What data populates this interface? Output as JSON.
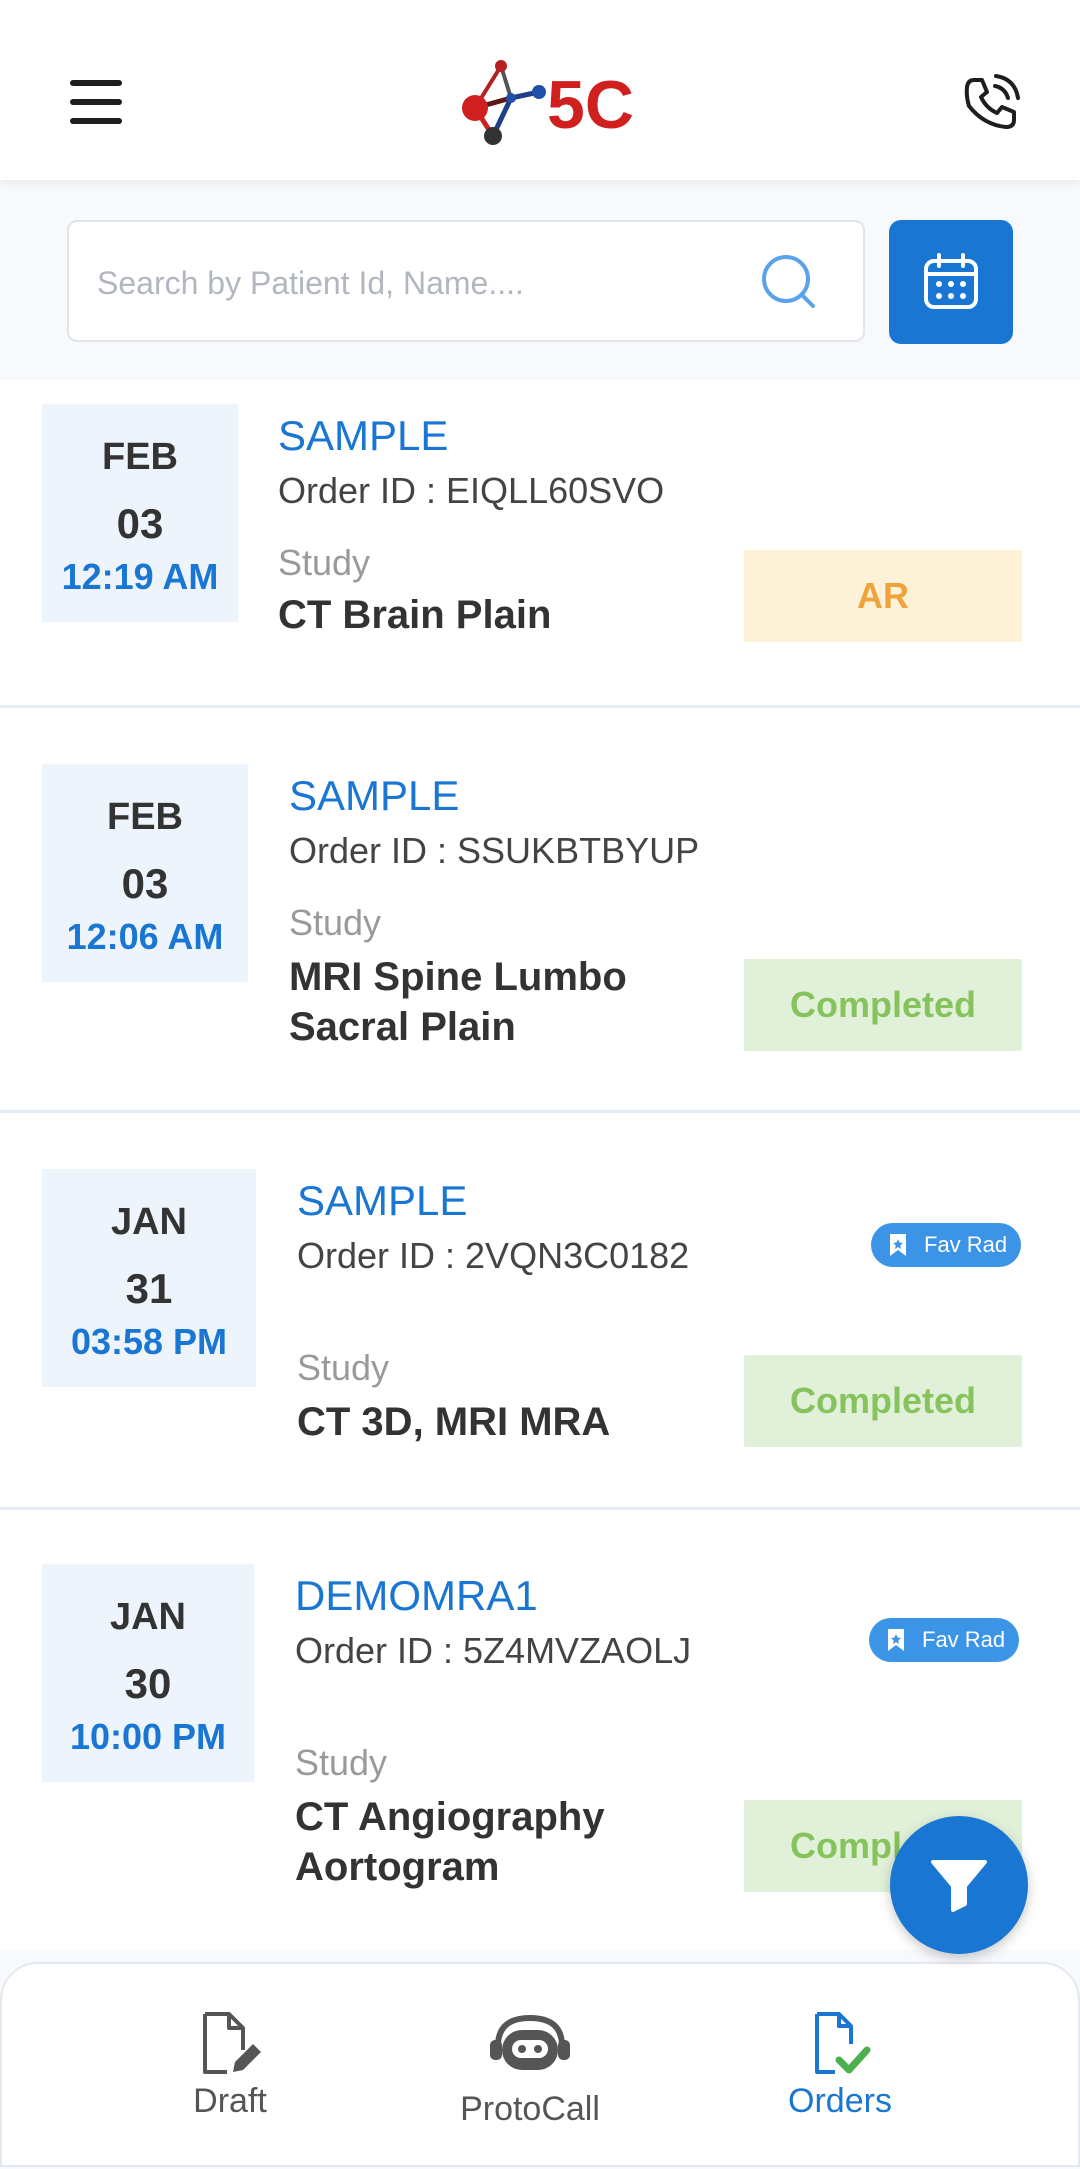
{
  "header": {
    "logo_text": "5C",
    "menu_icon": "hamburger-menu-icon",
    "phone_icon": "phone-call-icon"
  },
  "search": {
    "placeholder": "Search by Patient Id, Name....",
    "value": ""
  },
  "orders": [
    {
      "month": "FEB",
      "day": "03",
      "time": "12:19 AM",
      "patient": "SAMPLE",
      "order_id": "Order ID : EIQLL60SVO",
      "study_label": "Study",
      "study": "CT Brain Plain",
      "status": "AR",
      "fav": ""
    },
    {
      "month": "FEB",
      "day": "03",
      "time": "12:06 AM",
      "patient": "SAMPLE",
      "order_id": "Order ID : SSUKBTBYUP",
      "study_label": "Study",
      "study": "MRI Spine Lumbo Sacral Plain",
      "status": "Completed",
      "fav": ""
    },
    {
      "month": "JAN",
      "day": "31",
      "time": "03:58 PM",
      "patient": "SAMPLE",
      "order_id": "Order ID : 2VQN3C0182",
      "study_label": "Study",
      "study": "CT 3D, MRI MRA",
      "status": "Completed",
      "fav": "Fav Rad"
    },
    {
      "month": "JAN",
      "day": "30",
      "time": "10:00 PM",
      "patient": "DEMOMRA1",
      "order_id": "Order ID : 5Z4MVZAOLJ",
      "study_label": "Study",
      "study": "CT Angiography Aortogram",
      "status": "Completed",
      "fav": "Fav Rad"
    }
  ],
  "bottom_nav": [
    {
      "label": "Draft",
      "icon": "draft-document-icon",
      "active": false
    },
    {
      "label": "ProtoCall",
      "icon": "headset-robot-icon",
      "active": false
    },
    {
      "label": "Orders",
      "icon": "orders-check-icon",
      "active": true
    }
  ],
  "colors": {
    "primary": "#1976d2",
    "status_ar_bg": "#fdf1d8",
    "status_ar_text": "#eea43a",
    "status_completed_bg": "#e1f1d9",
    "status_completed_text": "#86c35c",
    "date_bg": "#edf4fc"
  }
}
